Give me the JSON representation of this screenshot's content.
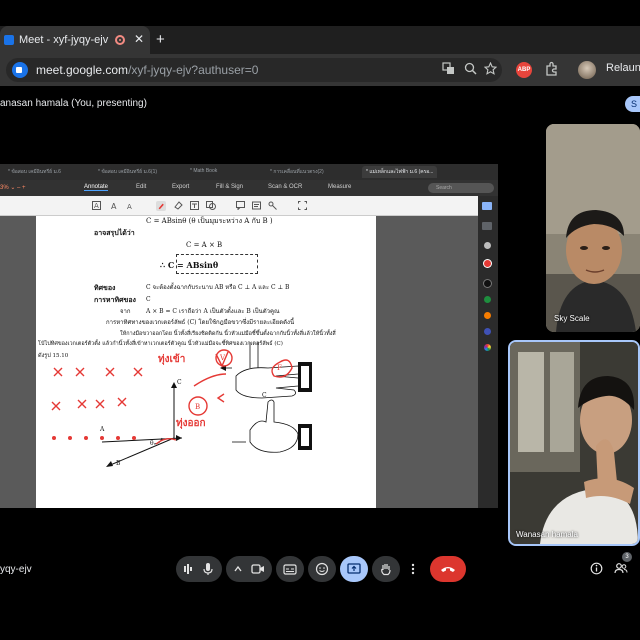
{
  "browser": {
    "tab_title": "Meet - xyf-jyqy-ejv",
    "close_glyph": "✕",
    "new_tab_glyph": "+",
    "url_host": "meet.google.com",
    "url_path": "/xyf-jyqy-ejv?authuser=0",
    "relaunch_label": "Relaunch",
    "abp_label": "ABP",
    "icons": [
      "translate-icon",
      "zoom-icon",
      "star-icon",
      "adblock-icon",
      "puzzle-icon",
      "profile-avatar"
    ]
  },
  "meet": {
    "presenter_label": "anasan hamala (You, presenting)",
    "stop_label": "S",
    "meeting_code": "yqy-ejv",
    "participants_count": "3"
  },
  "shared_app": {
    "tabs": [
      "* ข้อสอบ เคมีอินทรีย์ ม.6",
      "* ข้อสอบ เคมีอินทรีย์ ม.6(1)",
      "* Math Book",
      "* การเคลื่อนที่แนวตรง(2)",
      "* แม่เหล็กและไฟฟ้า ม.6 (ครอ..."
    ],
    "zoom": "3% ⌄   –   +",
    "toolbar": [
      "Annotate",
      "Edit",
      "Export",
      "Fill & Sign",
      "Scan & OCR",
      "Measure"
    ],
    "search_placeholder": "Search",
    "accent": "#4da3ff"
  },
  "document": {
    "lines": [
      "C = ABsinθ  (θ เป็นมุมระหว่าง A กับ B )",
      "อาจสรุปได้ว่า",
      "C  =  A × B",
      "∴    C   =   ABsinθ",
      "ทิศของ",
      "C จะต้องตั้งฉากกับระนาบ AB หรือ C ⊥ A และ C ⊥ B",
      "การหาทิศของ",
      "C",
      "จาก",
      "A × B   =   C   เราถือว่า A เป็นตัวตั้งและ B เป็นตัวคูณ",
      "การหาทิศทางของเวกเตอร์ลัพธ์ (C) โดยใช้กฎมือขวาซึ่งมีรายละเอียดดังนี้",
      "ให้กางมือขวาออกโดย  นิ้วทั้งสี่เรียงชิดติดกัน  นิ้วหัวแม่มือชี้ขึ้นตั้งฉากกับนิ้วทั้งสี่แล้วให้นิ้วทั้งสี่",
      "โบ้ไปทิศของเวกเตอร์ตัวตั้ง  แล้วกำนิ้วทั้งสี่เข้าหาเวกเตอร์ตัวคูณ นิ้วหัวแม่มือจะชี้ทิศของเวกเตอร์ลัพธ์ (C)",
      "ดังรูป 15.10",
      "A",
      "B",
      "θ",
      "C",
      "V",
      "F",
      "B",
      "C",
      "ทุ่งเข้า",
      "ทุ่งออก"
    ]
  },
  "tiles": {
    "remote_name": "Sky Scale",
    "self_name": "Wanasan hamala"
  }
}
